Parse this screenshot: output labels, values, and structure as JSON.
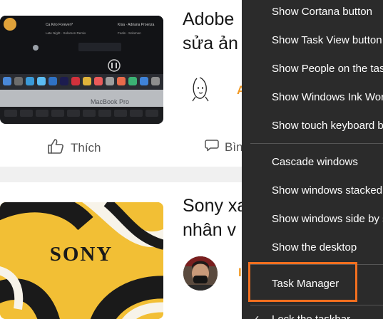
{
  "feed": {
    "article1": {
      "title_line1": "Adobe",
      "title_line2": "sửa ản",
      "author_initial": "A",
      "like_label": "Thích",
      "comment_label": "Bìn",
      "thumb_text": {
        "brand": "MacBook Pro",
        "song1": "Ca Kéo Forever?",
        "artist1": "Late Night · Solomon Remix",
        "playlist1": "Kísa · Adriana Proenza",
        "playlist2": "Foals · Solomon"
      }
    },
    "article2": {
      "title_line1": "Sony xa",
      "title_line2": "nhân v",
      "author_initial": "I",
      "thumb_text": "SONY"
    }
  },
  "context_menu": {
    "items": [
      {
        "label": "Show Cortana button"
      },
      {
        "label": "Show Task View button"
      },
      {
        "label": "Show People on the taskbar"
      },
      {
        "label": "Show Windows Ink Workspace button"
      },
      {
        "label": "Show touch keyboard button"
      },
      {
        "label": "Cascade windows"
      },
      {
        "label": "Show windows stacked"
      },
      {
        "label": "Show windows side by side"
      },
      {
        "label": "Show the desktop"
      },
      {
        "label": "Task Manager"
      },
      {
        "label": "Lock the taskbar"
      }
    ],
    "checked_item": "Lock the taskbar",
    "highlighted_item": "Task Manager"
  },
  "colors": {
    "menu_bg": "#2b2b2b",
    "highlight_border": "#f26f1f",
    "accent_orange": "#f29a26",
    "sony_yellow": "#f2bf35"
  },
  "icons": [
    "thumbs-up-icon",
    "comment-icon",
    "checkmark-icon"
  ]
}
